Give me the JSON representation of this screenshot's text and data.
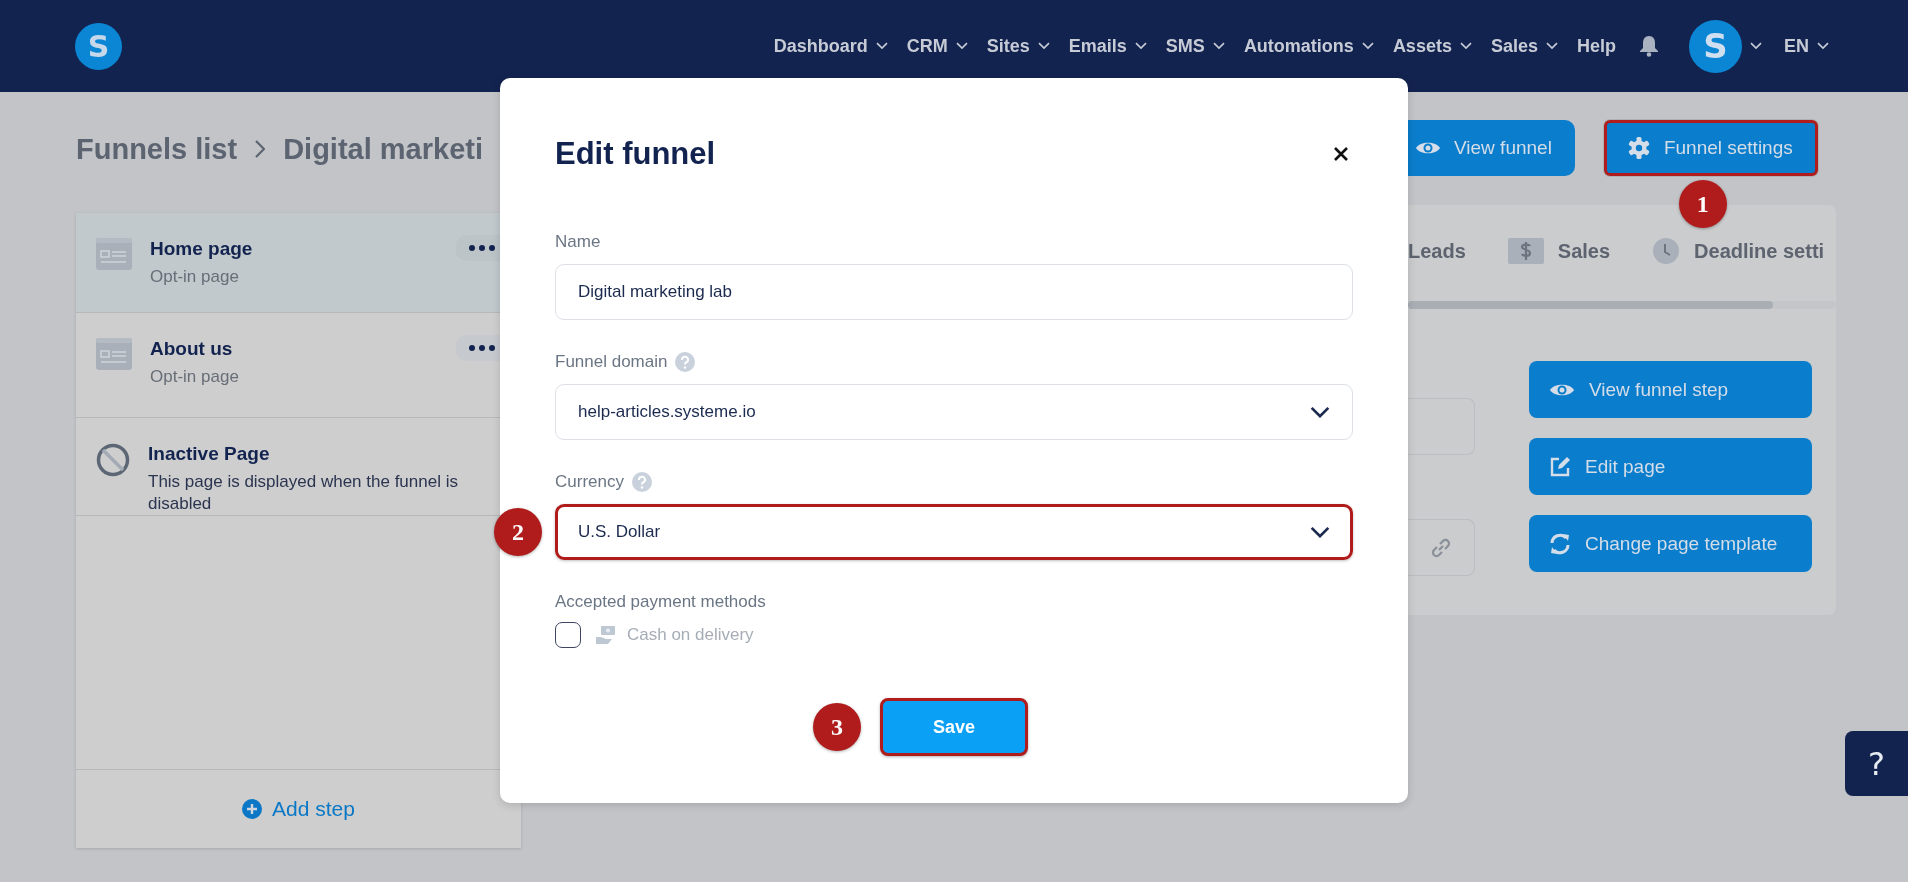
{
  "nav": {
    "logo": "S",
    "items": [
      {
        "label": "Dashboard",
        "dropdown": true
      },
      {
        "label": "CRM",
        "dropdown": true
      },
      {
        "label": "Sites",
        "dropdown": true
      },
      {
        "label": "Emails",
        "dropdown": true
      },
      {
        "label": "SMS",
        "dropdown": true
      },
      {
        "label": "Automations",
        "dropdown": true
      },
      {
        "label": "Assets",
        "dropdown": true
      },
      {
        "label": "Sales",
        "dropdown": true
      },
      {
        "label": "Help",
        "dropdown": false
      }
    ],
    "avatar": "S",
    "language": "EN"
  },
  "breadcrumb": [
    "Funnels list",
    "Digital marketi"
  ],
  "steps": [
    {
      "kind": "page",
      "title": "Home page",
      "subtitle": "Opt-in page",
      "selected": true
    },
    {
      "kind": "page",
      "title": "About us",
      "subtitle": "Opt-in page",
      "selected": false
    },
    {
      "kind": "inactive",
      "title": "Inactive Page",
      "subtitle": "This page is displayed when the funnel is disabled",
      "selected": false
    }
  ],
  "add_step": "Add step",
  "header_buttons": [
    {
      "label": "View funnel",
      "highlighted": false
    },
    {
      "label": "Funnel settings",
      "highlighted": true,
      "callout": "1"
    }
  ],
  "tabs": [
    {
      "label": "Leads"
    },
    {
      "label": "Sales"
    },
    {
      "label": "Deadline setti"
    }
  ],
  "step_actions": [
    {
      "label": "View funnel step"
    },
    {
      "label": "Edit page"
    },
    {
      "label": "Change page template"
    }
  ],
  "modal": {
    "title": "Edit funnel",
    "fields": [
      {
        "kind": "text",
        "label": "Name",
        "value": "Digital marketing lab",
        "help": false,
        "highlighted": false
      },
      {
        "kind": "select",
        "label": "Funnel domain",
        "value": "help-articles.systeme.io",
        "help": true,
        "highlighted": false
      },
      {
        "kind": "select",
        "label": "Currency",
        "value": "U.S. Dollar",
        "help": true,
        "highlighted": true,
        "callout": "2"
      }
    ],
    "payment_label": "Accepted payment methods",
    "payment_methods": [
      {
        "label": "Cash on delivery",
        "checked": false,
        "disabled": true
      }
    ],
    "save": {
      "label": "Save",
      "highlighted": true,
      "callout": "3"
    }
  },
  "help_button": "?"
}
